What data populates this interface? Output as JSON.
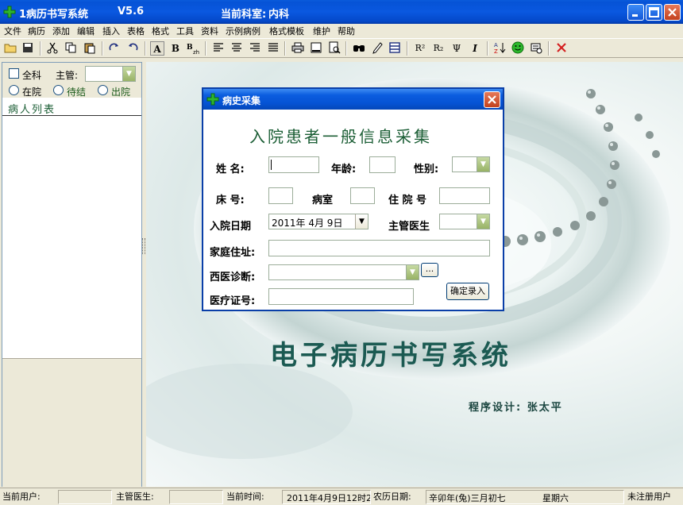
{
  "window": {
    "title": "1病历书写系统",
    "version": "V5.6",
    "dept_label": "当前科室:",
    "dept_value": "内科"
  },
  "menu": [
    "文件",
    "病历",
    "添加",
    "编辑",
    "插入",
    "表格",
    "格式",
    "工具",
    "资料",
    "示例病例",
    "格式模板",
    "维护",
    "帮助"
  ],
  "toolbar": {
    "icons": [
      "open-folder-icon",
      "save-icon",
      "cut-icon",
      "copy-icon",
      "paste-icon",
      "redo-icon",
      "undo-icon",
      "font-icon",
      "bold-icon",
      "chinese-convert-icon",
      "align-left-icon",
      "align-center-icon",
      "align-right-icon",
      "justify-icon",
      "print-icon",
      "page-setup-icon",
      "print-preview-icon",
      "find-icon",
      "pen-icon",
      "table-icon",
      "superscript-icon",
      "subscript-icon",
      "psi-icon",
      "italic-icon",
      "sort-az-icon",
      "smiley-icon",
      "stamp-icon",
      "delete-icon"
    ],
    "glyph_superscript": "R²",
    "glyph_subscript": "R₂",
    "glyph_psi": "Ψ",
    "glyph_italic": "I",
    "glyph_bold": "B",
    "glyph_font": "A"
  },
  "left": {
    "all_dept_label": "全科",
    "supervisor_label": "主管:",
    "in_hospital": "在院",
    "pending": "待结",
    "discharged": "出院",
    "list_header": "病人列表"
  },
  "dialog": {
    "title": "病史采集",
    "heading": "入院患者一般信息采集",
    "name_label": "姓  名:",
    "age_label": "年龄:",
    "sex_label": "性别:",
    "bed_label": "床  号:",
    "ward_label": "病室",
    "address_no_label": "住 院 号",
    "admit_date_label": "入院日期",
    "admit_date_value": "2011年 4月 9日",
    "doctor_label": "主管医生",
    "home_label": "家庭住址:",
    "diagnosis_label": "西医诊断:",
    "insurance_label": "医疗证号:",
    "confirm_button": "确定录入",
    "more_button": "..."
  },
  "main": {
    "title": "电子病历书写系统",
    "credit": "程序设计: 张太平"
  },
  "status": {
    "user_label": "当前用户:",
    "user_value": "",
    "doctor_label": "主管医生:",
    "doctor_value": "",
    "time_label": "当前时间:",
    "time_value": "2011年4月9日12时2",
    "lunar_label": "农历日期:",
    "lunar_value": "辛卯年(兔)三月初七",
    "weekday": "星期六",
    "registration": "未注册用户"
  },
  "colors": {
    "title_bar": "#0653d6",
    "heading_green": "#1b5e35",
    "main_title": "#1b5a52"
  }
}
